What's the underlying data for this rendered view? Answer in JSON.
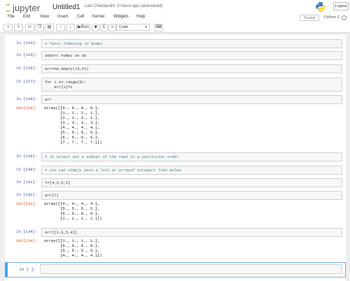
{
  "header": {
    "brand": "jupyter",
    "notebook_name": "Untitled1",
    "checkpoint_text": "Last Checkpoint: 3 hours ago  (autosaved)",
    "logout_label": "Logout",
    "trusted_label": "Trusted",
    "kernel_name": "Python 3"
  },
  "menubar": {
    "items": [
      {
        "label": "File"
      },
      {
        "label": "Edit"
      },
      {
        "label": "View"
      },
      {
        "label": "Insert"
      },
      {
        "label": "Cell"
      },
      {
        "label": "Kernel"
      },
      {
        "label": "Widgets"
      },
      {
        "label": "Help"
      }
    ]
  },
  "toolbar": {
    "save_icon": "floppy-icon",
    "add_icon": "plus-icon",
    "cut_icon": "scissors-icon",
    "copy_icon": "copy-icon",
    "paste_icon": "paste-icon",
    "up_icon": "arrow-up-icon",
    "down_icon": "arrow-down-icon",
    "run_label": "Run",
    "stop_icon": "stop-icon",
    "restart_icon": "restart-icon",
    "restart_run_icon": "fast-forward-icon",
    "cell_type": "Code",
    "keyboard_icon": "keyboard-icon"
  },
  "cells": [
    {
      "prompt": "In [124]:",
      "kind": "in",
      "input": "# fancy Indexing in Numpy"
    },
    {
      "prompt": "In [125]:",
      "kind": "in",
      "input": "import numpy as np"
    },
    {
      "prompt": "In [126]:",
      "kind": "in",
      "input": "arr=np.empty((8,4))"
    },
    {
      "prompt": "In [127]:",
      "kind": "in",
      "input": "for i in range(8):\n    arr[i]=i"
    },
    {
      "prompt": "In [128]:",
      "kind": "in",
      "input": "arr"
    },
    {
      "prompt": "Out[128]:",
      "kind": "out",
      "output": "array([[0., 0., 0., 0.],\n       [1., 1., 1., 1.],\n       [2., 2., 2., 2.],\n       [3., 3., 3., 3.],\n       [4., 4., 4., 4.],\n       [5., 5., 5., 5.],\n       [6., 6., 6., 6.],\n       [7., 7., 7., 7.]])"
    },
    {
      "prompt": "In [129]:",
      "kind": "in",
      "input": "# To select out a subset of the rows in a particular order"
    },
    {
      "prompt": "In [130]:",
      "kind": "in",
      "input": "# you can simply pass a list or arrayof integers like below"
    },
    {
      "prompt": "In [131]:",
      "kind": "in",
      "input": "l=[4,5,6,1]"
    },
    {
      "prompt": "In [132]:",
      "kind": "in",
      "input": "arr[l]"
    },
    {
      "prompt": "Out[132]:",
      "kind": "out",
      "output": "array([[4., 4., 4., 4.],\n       [5., 5., 5., 5.],\n       [6., 6., 6., 6.],\n       [1., 1., 1., 1.]])"
    },
    {
      "prompt": "In [134]:",
      "kind": "in",
      "input": "arr[[1,6,5,4]]"
    },
    {
      "prompt": "Out[134]:",
      "kind": "out",
      "output": "array([[1., 1., 1., 1.],\n       [6., 6., 6., 6.],\n       [5., 5., 5., 5.],\n       [4., 4., 4., 4.]])"
    },
    {
      "prompt": "In [ ]:",
      "kind": "in",
      "input": ""
    }
  ]
}
